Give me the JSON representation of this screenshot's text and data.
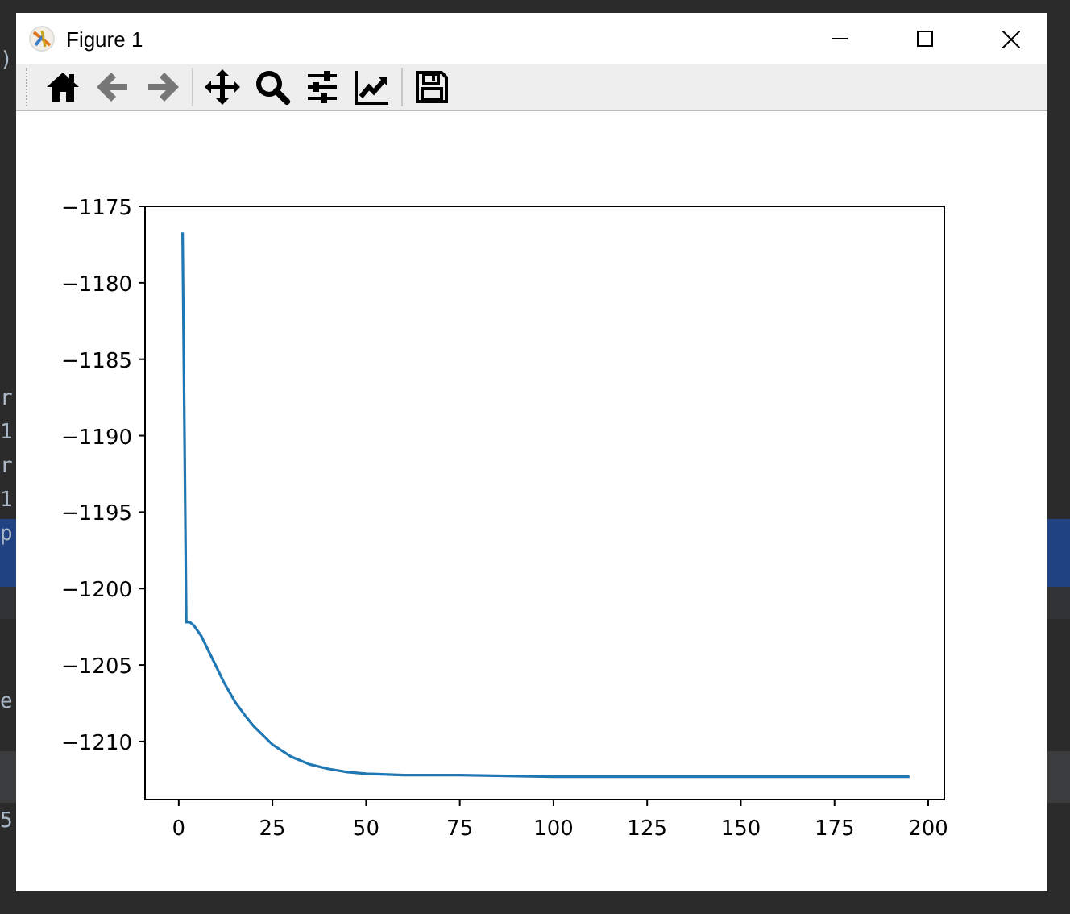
{
  "background_editor": {
    "fragments": [
      ")",
      "r",
      "1",
      "r",
      "1",
      "p",
      "e",
      "5"
    ]
  },
  "window": {
    "title": "Figure 1"
  },
  "toolbar": [
    {
      "kind": "home",
      "disabled": false
    },
    {
      "kind": "back",
      "disabled": true
    },
    {
      "kind": "forward",
      "disabled": true
    },
    {
      "kind": "separator"
    },
    {
      "kind": "pan",
      "disabled": false
    },
    {
      "kind": "zoom",
      "disabled": false
    },
    {
      "kind": "configure",
      "disabled": false
    },
    {
      "kind": "edit",
      "disabled": false
    },
    {
      "kind": "separator"
    },
    {
      "kind": "save",
      "disabled": false
    }
  ],
  "figure": {
    "chart_data": {
      "type": "line",
      "x": [
        1,
        2,
        3,
        4,
        6,
        8,
        10,
        12,
        15,
        18,
        20,
        25,
        30,
        35,
        40,
        45,
        50,
        60,
        75,
        100,
        150,
        195
      ],
      "series": [
        {
          "color": "#1f77b4",
          "values": [
            -1176.7,
            -1202.2,
            -1202.2,
            -1202.4,
            -1203.1,
            -1204.1,
            -1205.1,
            -1206.1,
            -1207.4,
            -1208.4,
            -1209.0,
            -1210.2,
            -1211.0,
            -1211.5,
            -1211.8,
            -1212.0,
            -1212.1,
            -1212.2,
            -1212.2,
            -1212.3,
            -1212.3,
            -1212.3
          ]
        }
      ],
      "xlim": [
        -9,
        204.3
      ],
      "ylim": [
        -1213.8,
        -1175
      ],
      "xticks": [
        0,
        25,
        50,
        75,
        100,
        125,
        150,
        175,
        200
      ],
      "yticks": [
        {
          "value": -1175,
          "label": "−1175"
        },
        {
          "value": -1180,
          "label": "−1180"
        },
        {
          "value": -1185,
          "label": "−1185"
        },
        {
          "value": -1190,
          "label": "−1190"
        },
        {
          "value": -1195,
          "label": "−1195"
        },
        {
          "value": -1200,
          "label": "−1200"
        },
        {
          "value": -1205,
          "label": "−1205"
        },
        {
          "value": -1210,
          "label": "−1210"
        }
      ]
    }
  }
}
